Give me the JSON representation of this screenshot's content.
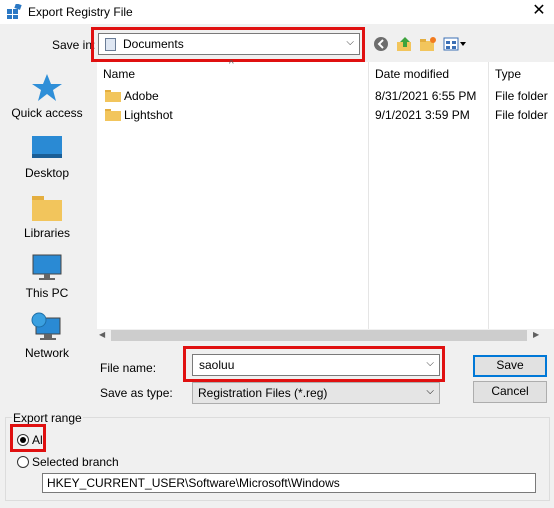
{
  "window": {
    "title": "Export Registry File",
    "close_glyph": "✕"
  },
  "save_in": {
    "label": "Save in:",
    "value": "Documents"
  },
  "toolbar": {
    "icons": [
      "back-icon",
      "up-folder-icon",
      "new-folder-icon",
      "view-menu-icon"
    ]
  },
  "places": [
    {
      "label": "Quick access",
      "icon": "quick-access-icon"
    },
    {
      "label": "Desktop",
      "icon": "desktop-icon"
    },
    {
      "label": "Libraries",
      "icon": "libraries-icon"
    },
    {
      "label": "This PC",
      "icon": "this-pc-icon"
    },
    {
      "label": "Network",
      "icon": "network-icon"
    }
  ],
  "file_list": {
    "columns": {
      "name": "Name",
      "date": "Date modified",
      "type": "Type"
    },
    "rows": [
      {
        "name": "Adobe",
        "date": "8/31/2021 6:55 PM",
        "type": "File folder"
      },
      {
        "name": "Lightshot",
        "date": "9/1/2021 3:59 PM",
        "type": "File folder"
      }
    ]
  },
  "file_name": {
    "label": "File name:",
    "value": "saoluu"
  },
  "save_as_type": {
    "label": "Save as type:",
    "value": "Registration Files (*.reg)"
  },
  "buttons": {
    "save": "Save",
    "cancel": "Cancel"
  },
  "export_range": {
    "label": "Export range",
    "all_label": "All",
    "selected_label": "Selected branch",
    "selected_option": "All",
    "branch_value": "HKEY_CURRENT_USER\\Software\\Microsoft\\Windows"
  },
  "colors": {
    "highlight_box": "#e01010",
    "folder": "#f2c55c",
    "accent": "#0078d7"
  }
}
